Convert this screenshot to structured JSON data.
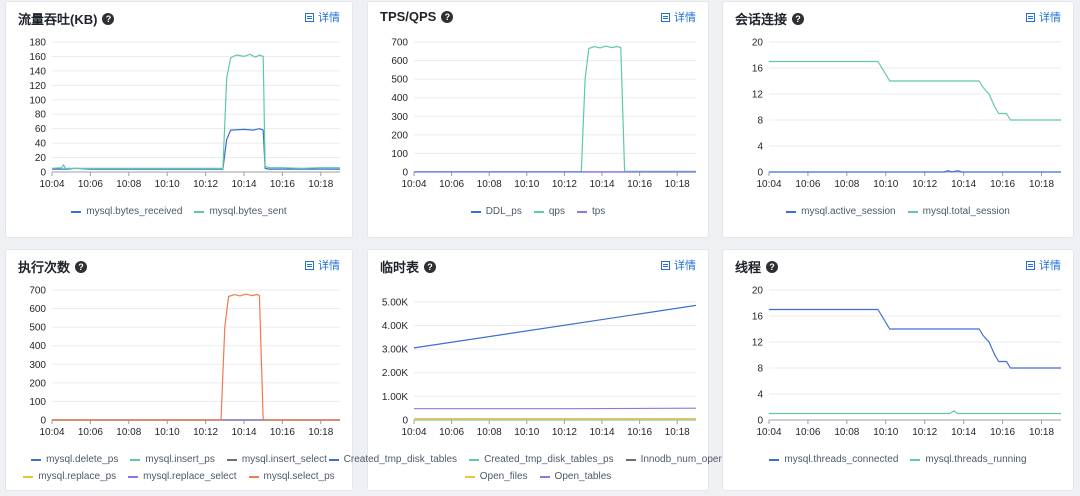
{
  "detail_label": "详情",
  "help_glyph": "?",
  "colors": {
    "blue": "#3c6fcf",
    "green": "#5fc9a6",
    "gray": "#6b6f75",
    "yellow": "#f0c330",
    "purple": "#8e78e8",
    "orange": "#ee7b4d",
    "grid": "#e8ebef",
    "axis": "#9aa0a8"
  },
  "chart_data": [
    {
      "id": "traffic",
      "title": "流量吞吐(KB)",
      "type": "line",
      "xlabels": [
        "10:04",
        "10:06",
        "10:08",
        "10:10",
        "10:12",
        "10:14",
        "10:16",
        "10:18"
      ],
      "xrange": [
        0,
        15
      ],
      "ylim": [
        0,
        180
      ],
      "yticks": [
        0,
        20,
        40,
        60,
        80,
        100,
        120,
        140,
        160,
        180
      ],
      "ytick_labels": [
        "0",
        "20",
        "40",
        "60",
        "80",
        "100",
        "120",
        "140",
        "160",
        "180"
      ],
      "series": [
        {
          "name": "mysql.bytes_received",
          "color": "#3c6fcf",
          "points": [
            [
              0,
              4
            ],
            [
              0.8,
              4
            ],
            [
              1.2,
              5
            ],
            [
              2,
              4
            ],
            [
              4,
              4
            ],
            [
              6,
              4
            ],
            [
              8.2,
              4
            ],
            [
              8.9,
              4
            ],
            [
              9.1,
              45
            ],
            [
              9.3,
              58
            ],
            [
              10,
              59
            ],
            [
              10.5,
              58
            ],
            [
              10.8,
              60
            ],
            [
              11,
              58
            ],
            [
              11.1,
              5
            ],
            [
              11.3,
              4
            ],
            [
              13,
              4
            ],
            [
              15,
              4
            ]
          ]
        },
        {
          "name": "mysql.bytes_sent",
          "color": "#5fc9a6",
          "points": [
            [
              0,
              5
            ],
            [
              0.5,
              6
            ],
            [
              0.6,
              10
            ],
            [
              0.7,
              5
            ],
            [
              1,
              5
            ],
            [
              3,
              5
            ],
            [
              5,
              5
            ],
            [
              7,
              5
            ],
            [
              8.9,
              5
            ],
            [
              9.1,
              130
            ],
            [
              9.3,
              158
            ],
            [
              9.6,
              162
            ],
            [
              10,
              160
            ],
            [
              10.3,
              163
            ],
            [
              10.6,
              159
            ],
            [
              10.8,
              162
            ],
            [
              11,
              160
            ],
            [
              11.1,
              8
            ],
            [
              11.3,
              6
            ],
            [
              12,
              6
            ],
            [
              13,
              5
            ],
            [
              14,
              6
            ],
            [
              15,
              6
            ]
          ]
        }
      ]
    },
    {
      "id": "tpsqps",
      "title": "TPS/QPS",
      "type": "line",
      "xlabels": [
        "10:04",
        "10:06",
        "10:08",
        "10:10",
        "10:12",
        "10:14",
        "10:16",
        "10:18"
      ],
      "xrange": [
        0,
        15
      ],
      "ylim": [
        0,
        700
      ],
      "yticks": [
        0,
        100,
        200,
        300,
        400,
        500,
        600,
        700
      ],
      "ytick_labels": [
        "0",
        "100",
        "200",
        "300",
        "400",
        "500",
        "600",
        "700"
      ],
      "series": [
        {
          "name": "DDL_ps",
          "color": "#3c6fcf",
          "points": [
            [
              0,
              0
            ],
            [
              15,
              0
            ]
          ]
        },
        {
          "name": "qps",
          "color": "#5fc9a6",
          "points": [
            [
              0,
              2
            ],
            [
              8.9,
              2
            ],
            [
              9.1,
              500
            ],
            [
              9.3,
              665
            ],
            [
              9.6,
              675
            ],
            [
              9.9,
              668
            ],
            [
              10.2,
              678
            ],
            [
              10.5,
              670
            ],
            [
              10.8,
              676
            ],
            [
              11,
              670
            ],
            [
              11.2,
              3
            ],
            [
              15,
              3
            ]
          ]
        },
        {
          "name": "tps",
          "color": "#8e78e8",
          "points": [
            [
              0,
              1
            ],
            [
              15,
              1
            ]
          ]
        }
      ]
    },
    {
      "id": "sessions",
      "title": "会话连接",
      "type": "line",
      "xlabels": [
        "10:04",
        "10:06",
        "10:08",
        "10:10",
        "10:12",
        "10:14",
        "10:16",
        "10:18"
      ],
      "xrange": [
        0,
        15
      ],
      "ylim": [
        0,
        20
      ],
      "yticks": [
        0,
        4,
        8,
        12,
        16,
        20
      ],
      "ytick_labels": [
        "0",
        "4",
        "8",
        "12",
        "16",
        "20"
      ],
      "series": [
        {
          "name": "mysql.active_session",
          "color": "#3c6fcf",
          "points": [
            [
              0,
              0
            ],
            [
              9,
              0
            ],
            [
              9.2,
              0.2
            ],
            [
              9.4,
              0
            ],
            [
              9.7,
              0.2
            ],
            [
              9.9,
              0
            ],
            [
              15,
              0
            ]
          ]
        },
        {
          "name": "mysql.total_session",
          "color": "#5fc9a6",
          "points": [
            [
              0,
              17
            ],
            [
              5.6,
              17
            ],
            [
              5.8,
              16
            ],
            [
              6,
              15
            ],
            [
              6.2,
              14
            ],
            [
              10.8,
              14
            ],
            [
              11,
              13
            ],
            [
              11.3,
              12
            ],
            [
              11.6,
              10
            ],
            [
              11.8,
              9
            ],
            [
              12.2,
              9
            ],
            [
              12.4,
              8
            ],
            [
              15,
              8
            ]
          ]
        }
      ]
    },
    {
      "id": "exec",
      "title": "执行次数",
      "type": "line",
      "xlabels": [
        "10:04",
        "10:06",
        "10:08",
        "10:10",
        "10:12",
        "10:14",
        "10:16",
        "10:18"
      ],
      "xrange": [
        0,
        15
      ],
      "ylim": [
        0,
        700
      ],
      "yticks": [
        0,
        100,
        200,
        300,
        400,
        500,
        600,
        700
      ],
      "ytick_labels": [
        "0",
        "100",
        "200",
        "300",
        "400",
        "500",
        "600",
        "700"
      ],
      "series": [
        {
          "name": "mysql.delete_ps",
          "color": "#3c6fcf",
          "points": [
            [
              0,
              0
            ],
            [
              15,
              0
            ]
          ]
        },
        {
          "name": "mysql.insert_ps",
          "color": "#5fc9a6",
          "points": [
            [
              0,
              0
            ],
            [
              15,
              0
            ]
          ]
        },
        {
          "name": "mysql.insert_select",
          "color": "#6b6f75",
          "points": [
            [
              0,
              0
            ],
            [
              15,
              0
            ]
          ]
        },
        {
          "name": "mysql.replace_ps",
          "color": "#f0c330",
          "points": [
            [
              0,
              0
            ],
            [
              15,
              0
            ]
          ]
        },
        {
          "name": "mysql.replace_select",
          "color": "#8e78e8",
          "points": [
            [
              0,
              0
            ],
            [
              15,
              0
            ]
          ]
        },
        {
          "name": "mysql.select_ps",
          "color": "#ee7b4d",
          "points": [
            [
              0,
              0
            ],
            [
              8.8,
              0
            ],
            [
              9.0,
              500
            ],
            [
              9.2,
              665
            ],
            [
              9.5,
              675
            ],
            [
              9.8,
              668
            ],
            [
              10.1,
              678
            ],
            [
              10.4,
              670
            ],
            [
              10.7,
              676
            ],
            [
              10.8,
              670
            ],
            [
              11,
              0
            ],
            [
              15,
              0
            ]
          ]
        }
      ]
    },
    {
      "id": "tmptables",
      "title": "临时表",
      "type": "line",
      "xlabels": [
        "10:04",
        "10:06",
        "10:08",
        "10:10",
        "10:12",
        "10:14",
        "10:16",
        "10:18"
      ],
      "xrange": [
        0,
        15
      ],
      "ylim": [
        0,
        5500
      ],
      "yticks": [
        0,
        1000,
        2000,
        3000,
        4000,
        5000
      ],
      "ytick_labels": [
        "0",
        "1.00K",
        "2.00K",
        "3.00K",
        "4.00K",
        "5.00K"
      ],
      "series": [
        {
          "name": "Created_tmp_disk_tables",
          "color": "#3c6fcf",
          "points": [
            [
              0,
              3050
            ],
            [
              15,
              4850
            ]
          ]
        },
        {
          "name": "Created_tmp_disk_tables_ps",
          "color": "#5fc9a6",
          "points": [
            [
              0,
              0
            ],
            [
              15,
              0
            ]
          ]
        },
        {
          "name": "Innodb_num_open_files",
          "color": "#6b6f75",
          "points": [
            [
              0,
              40
            ],
            [
              15,
              40
            ]
          ]
        },
        {
          "name": "Open_files",
          "color": "#f0c330",
          "points": [
            [
              0,
              20
            ],
            [
              15,
              20
            ]
          ]
        },
        {
          "name": "Open_tables",
          "color": "#8e78e8",
          "points": [
            [
              0,
              480
            ],
            [
              8,
              480
            ],
            [
              15,
              500
            ]
          ]
        }
      ]
    },
    {
      "id": "threads",
      "title": "线程",
      "type": "line",
      "xlabels": [
        "10:04",
        "10:06",
        "10:08",
        "10:10",
        "10:12",
        "10:14",
        "10:16",
        "10:18"
      ],
      "xrange": [
        0,
        15
      ],
      "ylim": [
        0,
        20
      ],
      "yticks": [
        0,
        4,
        8,
        12,
        16,
        20
      ],
      "ytick_labels": [
        "0",
        "4",
        "8",
        "12",
        "16",
        "20"
      ],
      "series": [
        {
          "name": "mysql.threads_connected",
          "color": "#3c6fcf",
          "points": [
            [
              0,
              17
            ],
            [
              5.6,
              17
            ],
            [
              5.8,
              16
            ],
            [
              6,
              15
            ],
            [
              6.2,
              14
            ],
            [
              10.8,
              14
            ],
            [
              11,
              13
            ],
            [
              11.3,
              12
            ],
            [
              11.6,
              10
            ],
            [
              11.8,
              9
            ],
            [
              12.2,
              9
            ],
            [
              12.4,
              8
            ],
            [
              15,
              8
            ]
          ]
        },
        {
          "name": "mysql.threads_running",
          "color": "#5fc9a6",
          "points": [
            [
              0,
              1
            ],
            [
              9.3,
              1
            ],
            [
              9.5,
              1.4
            ],
            [
              9.7,
              1
            ],
            [
              15,
              1
            ]
          ]
        }
      ]
    }
  ]
}
